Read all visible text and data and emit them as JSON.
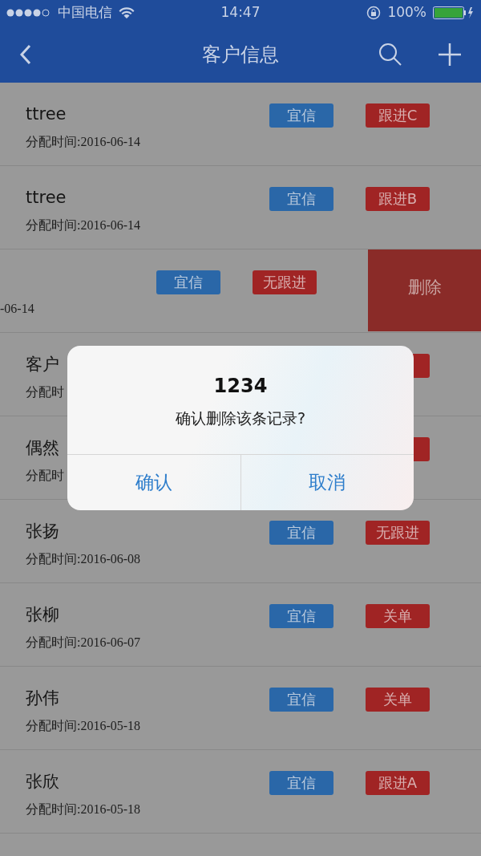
{
  "status_bar": {
    "carrier": "中国电信",
    "time": "14:47",
    "battery": "100%"
  },
  "nav": {
    "title": "客户信息"
  },
  "customers": [
    {
      "name": "ttree",
      "date": "分配时间:2016-06-14",
      "tag1": "宜信",
      "tag2": "跟进C",
      "swiped": false,
      "covered": false
    },
    {
      "name": "ttree",
      "date": "分配时间:2016-06-14",
      "tag1": "宜信",
      "tag2": "跟进B",
      "swiped": false,
      "covered": false
    },
    {
      "date": "-06-14",
      "tag1": "宜信",
      "tag2": "无跟进",
      "swiped": true,
      "delete_label": "删除",
      "covered": false
    },
    {
      "name": "客户",
      "date": "分配时",
      "swiped": false,
      "covered": true
    },
    {
      "name": "偶然",
      "date": "分配时",
      "swiped": false,
      "covered": true
    },
    {
      "name": "张扬",
      "date": "分配时间:2016-06-08",
      "tag1": "宜信",
      "tag2": "无跟进",
      "swiped": false,
      "covered": false
    },
    {
      "name": "张柳",
      "date": "分配时间:2016-06-07",
      "tag1": "宜信",
      "tag2": "关单",
      "swiped": false,
      "covered": false
    },
    {
      "name": "孙伟",
      "date": "分配时间:2016-05-18",
      "tag1": "宜信",
      "tag2": "关单",
      "swiped": false,
      "covered": false
    },
    {
      "name": "张欣",
      "date": "分配时间:2016-05-18",
      "tag1": "宜信",
      "tag2": "跟进A",
      "swiped": false,
      "covered": false
    }
  ],
  "dialog": {
    "title": "1234",
    "message": "确认删除该条记录?",
    "buttons": [
      "确认",
      "取消"
    ]
  }
}
